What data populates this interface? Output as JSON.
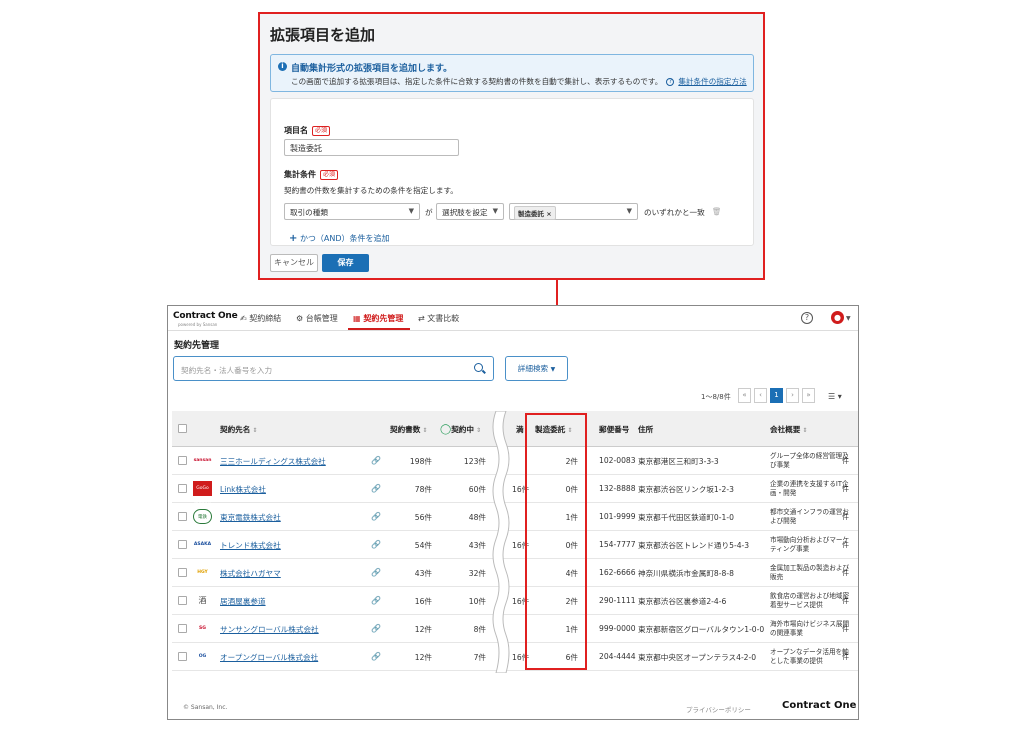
{
  "dialog": {
    "title": "拡張項目を追加",
    "info_title": "自動集計形式の拡張項目を追加します。",
    "info_desc": "この画面で追加する拡張項目は、指定した条件に合致する契約書の件数を自動で集計し、表示するものです。",
    "info_link": "集計条件の指定方法",
    "item_name_label": "項目名",
    "required_badge": "必須",
    "item_name_value": "製造委託",
    "condition_label": "集計条件",
    "condition_desc": "契約書の件数を集計するための条件を指定します。",
    "field_select": "取引の種類",
    "word_ga": "が",
    "operator_select": "選択肢を設定",
    "chip_value": "製造委託",
    "chip_close": "×",
    "match_text": "のいずれかと一致",
    "add_condition": "かつ（AND）条件を追加",
    "cancel": "キャンセル",
    "save": "保存"
  },
  "app": {
    "logo": "Contract One",
    "logo_sub": "powered by Sansan",
    "nav": [
      "契約締結",
      "台帳管理",
      "契約先管理",
      "文書比較"
    ],
    "active_nav": "契約先管理",
    "page_title": "契約先管理",
    "search_placeholder": "契約先名・法人番号を入力",
    "advanced_search": "詳細検索",
    "pager_count": "1〜8/8件",
    "pager": {
      "first": "«",
      "prev": "‹",
      "current": "1",
      "next": "›",
      "last": "»"
    },
    "columns": {
      "name": "契約先名",
      "contract_count": "契約書数",
      "active": "契約中",
      "partial": "満",
      "manufacturing": "製造委託",
      "postal": "郵便番号",
      "address": "住所",
      "summary": "会社概要"
    },
    "rows": [
      {
        "logo": "sansan",
        "name": "三三ホールディングス株式会社",
        "contracts": "198件",
        "active": "123件",
        "partial": "",
        "mfg": "2件",
        "postal": "102-0083",
        "address": "東京都港区三和町3-3-3",
        "summary": "グループ全体の経営管理及び事業",
        "ext": "件"
      },
      {
        "logo": "GoGo Agency",
        "name": "Link株式会社",
        "contracts": "78件",
        "active": "60件",
        "partial": "16件",
        "mfg": "0件",
        "postal": "132-8888",
        "address": "東京都渋谷区リンク坂1-2-3",
        "summary": "企業の連携を支援するIT企画・開発",
        "ext": "件"
      },
      {
        "logo": "電鉄",
        "name": "東京電鉄株式会社",
        "contracts": "56件",
        "active": "48件",
        "partial": "",
        "mfg": "1件",
        "postal": "101-9999",
        "address": "東京都千代田区鉄道町0-1-0",
        "summary": "都市交通インフラの運営および開発",
        "ext": "件"
      },
      {
        "logo": "ASAKA",
        "name": "トレンド株式会社",
        "contracts": "54件",
        "active": "43件",
        "partial": "16件",
        "mfg": "0件",
        "postal": "154-7777",
        "address": "東京都渋谷区トレンド通り5-4-3",
        "summary": "市場動向分析およびマーケティング事業",
        "ext": "件"
      },
      {
        "logo": "HGY",
        "name": "株式会社ハガヤマ",
        "contracts": "43件",
        "active": "32件",
        "partial": "",
        "mfg": "4件",
        "postal": "162-6666",
        "address": "神奈川県横浜市金属町8-8-8",
        "summary": "金属加工製品の製造および販売",
        "ext": "件"
      },
      {
        "logo": "酒",
        "name": "居酒屋裏参道",
        "contracts": "16件",
        "active": "10件",
        "partial": "16件",
        "mfg": "2件",
        "postal": "290-1111",
        "address": "東京都渋谷区裏参道2-4-6",
        "summary": "飲食店の運営および地域密着型サービス提供",
        "ext": "件"
      },
      {
        "logo": "SG",
        "name": "サンサングローバル株式会社",
        "contracts": "12件",
        "active": "8件",
        "partial": "",
        "mfg": "1件",
        "postal": "999-0000",
        "address": "東京都新宿区グローバルタウン1-0-0",
        "summary": "海外市場向けビジネス展開の関連事業",
        "ext": "件"
      },
      {
        "logo": "OG",
        "name": "オープングローバル株式会社",
        "contracts": "12件",
        "active": "7件",
        "partial": "16件",
        "mfg": "6件",
        "postal": "204-4444",
        "address": "東京都中央区オープンテラス4-2-0",
        "summary": "オープンなデータ活用を軸とした事業の提供",
        "ext": "件"
      }
    ],
    "footer_copyright": "© Sansan, Inc.",
    "footer_privacy": "プライバシーポリシー",
    "footer_logo": "Contract One"
  },
  "colors": {
    "accent_red": "#e02020",
    "brand_blue": "#1b6fb5"
  }
}
